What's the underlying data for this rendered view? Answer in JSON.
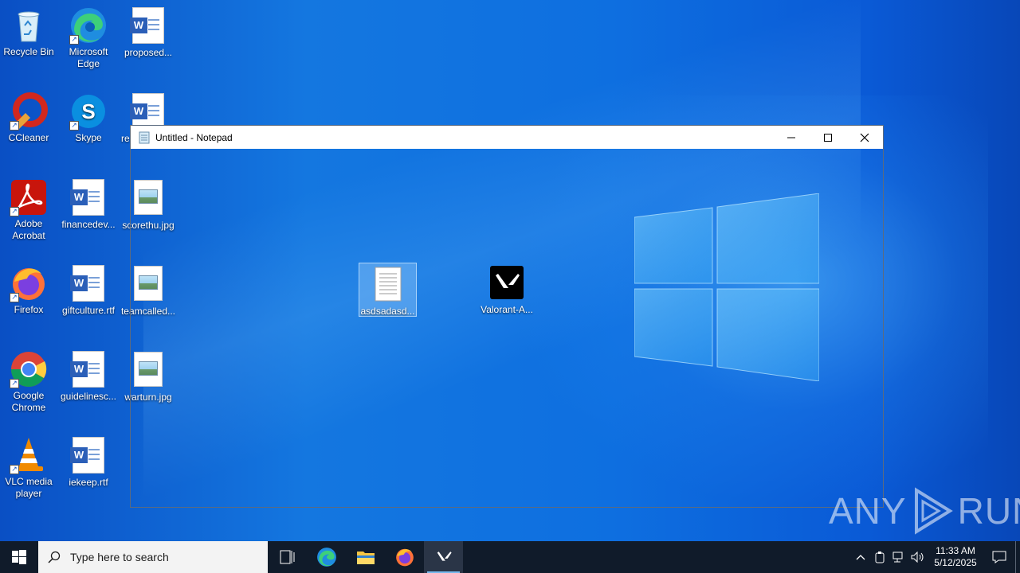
{
  "desktop": {
    "icons": [
      {
        "label": "Recycle Bin"
      },
      {
        "label": "Microsoft Edge"
      },
      {
        "label": "proposed..."
      },
      {
        "label": "CCleaner"
      },
      {
        "label": "Skype"
      },
      {
        "label": "re..."
      },
      {
        "label": "Adobe Acrobat"
      },
      {
        "label": "financedev..."
      },
      {
        "label": "scorethu.jpg"
      },
      {
        "label": "Firefox"
      },
      {
        "label": "giftculture.rtf"
      },
      {
        "label": "teamcalled..."
      },
      {
        "label": "Google Chrome"
      },
      {
        "label": "guidelinesc..."
      },
      {
        "label": "warturn.jpg"
      },
      {
        "label": "VLC media player"
      },
      {
        "label": "iekeep.rtf"
      },
      {
        "label": "asdsadasd..."
      },
      {
        "label": "Valorant-A..."
      }
    ]
  },
  "notepad": {
    "title": "Untitled - Notepad"
  },
  "taskbar": {
    "search_placeholder": "Type here to search",
    "time": "11:33 AM",
    "date": "5/12/2025"
  },
  "watermark": {
    "text_left": "ANY",
    "text_right": "RUN"
  },
  "colors": {
    "taskbar": "#101b2a",
    "accent": "#76b9ed"
  }
}
